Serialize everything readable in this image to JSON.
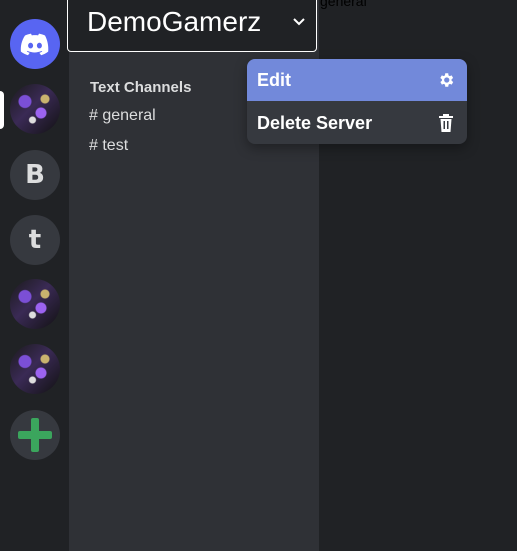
{
  "servers": {
    "home_icon": "discord-logo-icon",
    "letters": [
      "B",
      "t"
    ],
    "add_icon": "plus-icon"
  },
  "sidebar": {
    "server_name": "DemoGamerz",
    "header_icon": "chevron-down-icon",
    "section_title": "Text Channels",
    "channels": [
      "# general",
      "# test"
    ]
  },
  "main": {
    "channel_title": "general"
  },
  "context_menu": {
    "edit_label": "Edit",
    "edit_icon": "gear-icon",
    "delete_label": "Delete Server",
    "delete_icon": "trash-icon"
  },
  "colors": {
    "blurple": "#5865f2",
    "menu_highlight": "#7289da",
    "add_green": "#3ba55d"
  }
}
